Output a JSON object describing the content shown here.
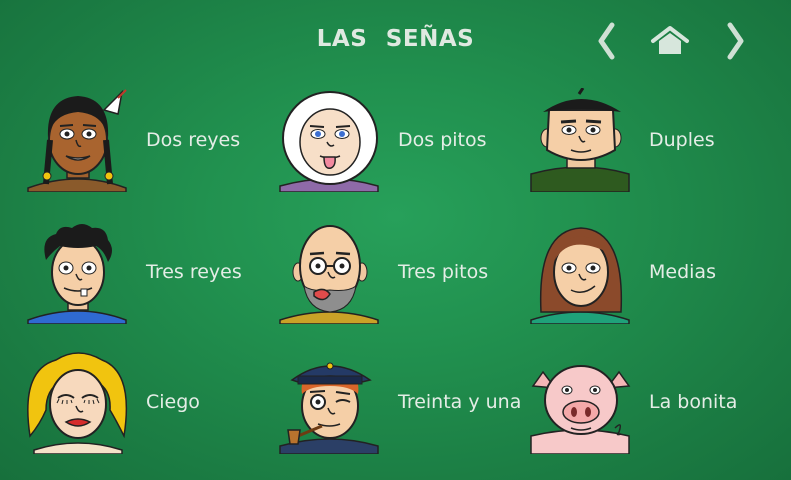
{
  "header": {
    "title": "LAS SEÑAS",
    "icons": [
      "chevron-left-icon",
      "home-icon",
      "chevron-right-icon"
    ]
  },
  "colors": {
    "background": "#1f8a4b",
    "text": "#e4ede6"
  },
  "signs": [
    {
      "label": "Dos reyes",
      "icon": "native-man-feather-face"
    },
    {
      "label": "Dos pitos",
      "icon": "eskimo-tongue-face"
    },
    {
      "label": "Duples",
      "icon": "beret-man-face"
    },
    {
      "label": "Tres reyes",
      "icon": "curly-hair-toothy-face"
    },
    {
      "label": "Tres pitos",
      "icon": "bald-glasses-tongue-face"
    },
    {
      "label": "Medias",
      "icon": "brown-hair-woman-face"
    },
    {
      "label": "Ciego",
      "icon": "blonde-woman-closed-eyes-face"
    },
    {
      "label": "Treinta y una",
      "icon": "sailor-pipe-wink-face"
    },
    {
      "label": "La bonita",
      "icon": "pig-face"
    }
  ]
}
